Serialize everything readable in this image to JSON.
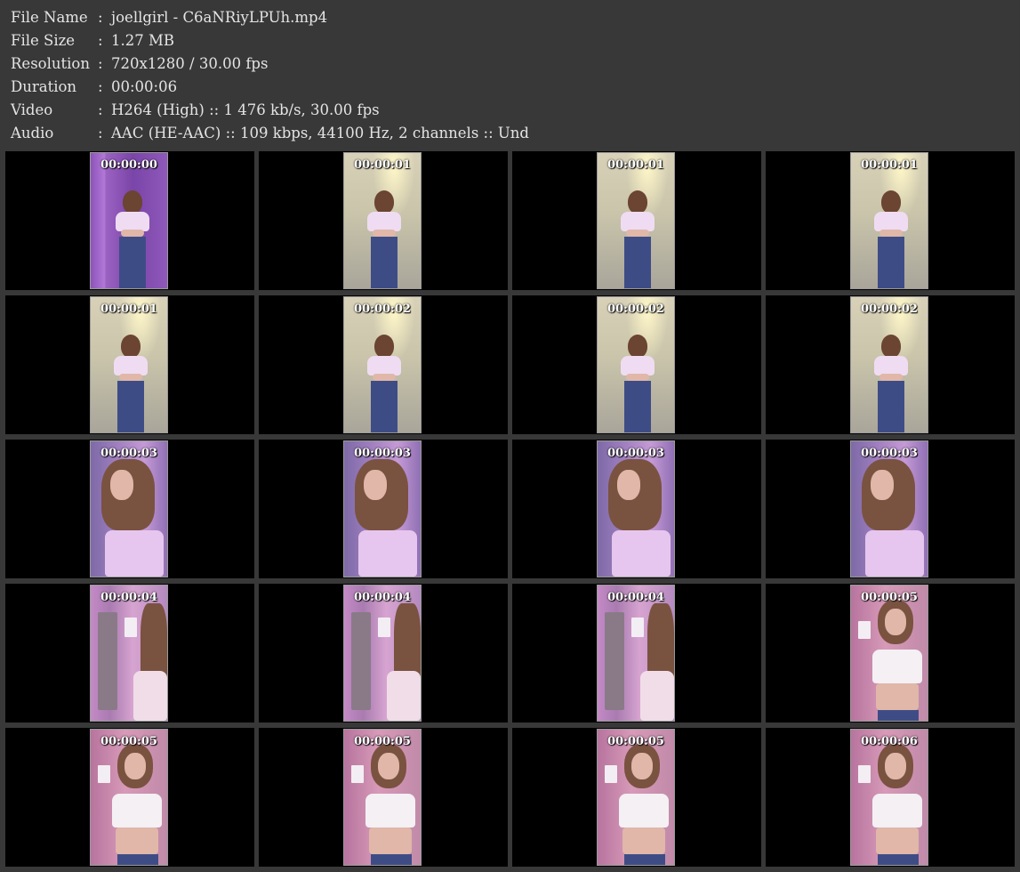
{
  "info": [
    {
      "label": "File Name",
      "sep": ":",
      "value": "joellgirl - C6aNRiyLPUh.mp4"
    },
    {
      "label": "File Size",
      "sep": ":",
      "value": "1.27 MB"
    },
    {
      "label": "Resolution",
      "sep": ":",
      "value": "720x1280 / 30.00 fps"
    },
    {
      "label": "Duration",
      "sep": ":",
      "value": "00:00:06"
    },
    {
      "label": "Video",
      "sep": ":",
      "value": "H264 (High) :: 1 476 kb/s, 30.00 fps"
    },
    {
      "label": "Audio",
      "sep": ":",
      "value": "AAC (HE-AAC) :: 109 kbps, 44100 Hz, 2 channels :: Und"
    }
  ],
  "thumbnails": [
    {
      "time": "00:00:00",
      "scene": "door"
    },
    {
      "time": "00:00:01",
      "scene": "room"
    },
    {
      "time": "00:00:01",
      "scene": "room"
    },
    {
      "time": "00:00:01",
      "scene": "room"
    },
    {
      "time": "00:00:01",
      "scene": "room"
    },
    {
      "time": "00:00:02",
      "scene": "room"
    },
    {
      "time": "00:00:02",
      "scene": "room"
    },
    {
      "time": "00:00:02",
      "scene": "room"
    },
    {
      "time": "00:00:03",
      "scene": "close"
    },
    {
      "time": "00:00:03",
      "scene": "close"
    },
    {
      "time": "00:00:03",
      "scene": "close"
    },
    {
      "time": "00:00:03",
      "scene": "close"
    },
    {
      "time": "00:00:04",
      "scene": "elev"
    },
    {
      "time": "00:00:04",
      "scene": "elev"
    },
    {
      "time": "00:00:04",
      "scene": "elev"
    },
    {
      "time": "00:00:05",
      "scene": "mirror"
    },
    {
      "time": "00:00:05",
      "scene": "mirror"
    },
    {
      "time": "00:00:05",
      "scene": "mirror"
    },
    {
      "time": "00:00:05",
      "scene": "mirror"
    },
    {
      "time": "00:00:06",
      "scene": "mirror"
    }
  ]
}
